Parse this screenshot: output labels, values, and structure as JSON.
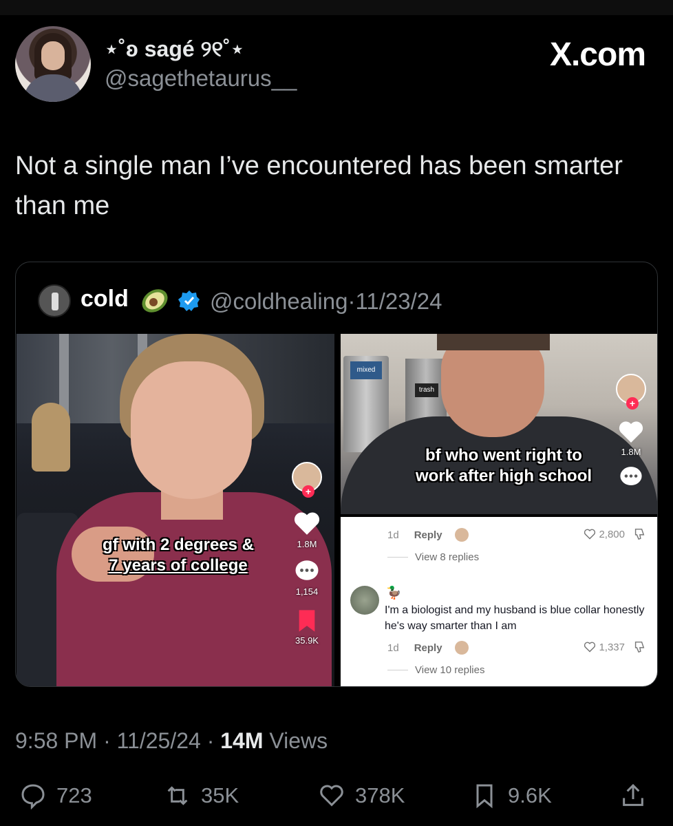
{
  "tweet": {
    "display_name": "⋆˚ʚ sagé ୨୧˚⋆",
    "handle": "@sagethetaurus__",
    "site": "X.com",
    "text": "Not a single man I’ve encountered has been smarter than me",
    "time": "9:58 PM",
    "date": "11/25/24",
    "views_count": "14M",
    "views_label": "Views"
  },
  "quote": {
    "name": "cold",
    "handle": "@coldhealing",
    "date": "11/23/24",
    "left_caption_line1": "gf with 2 degrees &",
    "left_caption_line2": "7 years of college",
    "left_likes": "1.8M",
    "left_comments": "1,154",
    "left_saves": "35.9K",
    "right_caption_line1": "bf who went right to",
    "right_caption_line2": "work after high school",
    "right_likes": "1.8M",
    "bin_label_1": "mixed",
    "bin_label_2": "trash",
    "comment1_age": "1d",
    "comment1_reply": "Reply",
    "comment1_likes": "2,800",
    "comment1_view_replies": "View 8 replies",
    "comment2_text": "I'm a biologist and my husband is blue collar honestly he's way smarter than I am",
    "comment2_age": "1d",
    "comment2_reply": "Reply",
    "comment2_likes": "1,337",
    "comment2_view_replies": "View 10 replies"
  },
  "actions": {
    "replies": "723",
    "reposts": "35K",
    "likes": "378K",
    "bookmarks": "9.6K"
  },
  "colors": {
    "background": "#000000",
    "muted_text": "#8b9096",
    "verified_blue": "#1d9bf0",
    "tiktok_red": "#fe2c55"
  }
}
